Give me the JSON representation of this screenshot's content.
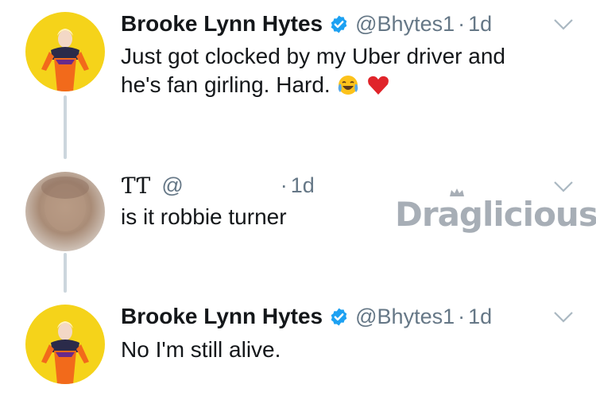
{
  "tweets": [
    {
      "name": "Brooke Lynn Hytes",
      "handle": "@Bhytes1",
      "dot": "·",
      "time": "1d",
      "text_line1": "Just got clocked by my Uber driver and",
      "text_line2": "he's fan girling. Hard.",
      "emojis": [
        "face-with-tears-of-joy",
        "red-heart"
      ]
    },
    {
      "name": "ƬƬ",
      "handle": "@",
      "dot": "·",
      "time": "1d",
      "text_line1": "is it robbie turner"
    },
    {
      "name": "Brooke Lynn Hytes",
      "handle": "@Bhytes1",
      "dot": "·",
      "time": "1d",
      "text_line1": "No I'm still alive."
    }
  ],
  "watermark": "Draglicious",
  "colors": {
    "avatar_bg": "#f5d31a",
    "outfit": "#f26a1b",
    "verified": "#1da1f2",
    "muted": "#657786",
    "thread_line": "#ccd6dd"
  }
}
